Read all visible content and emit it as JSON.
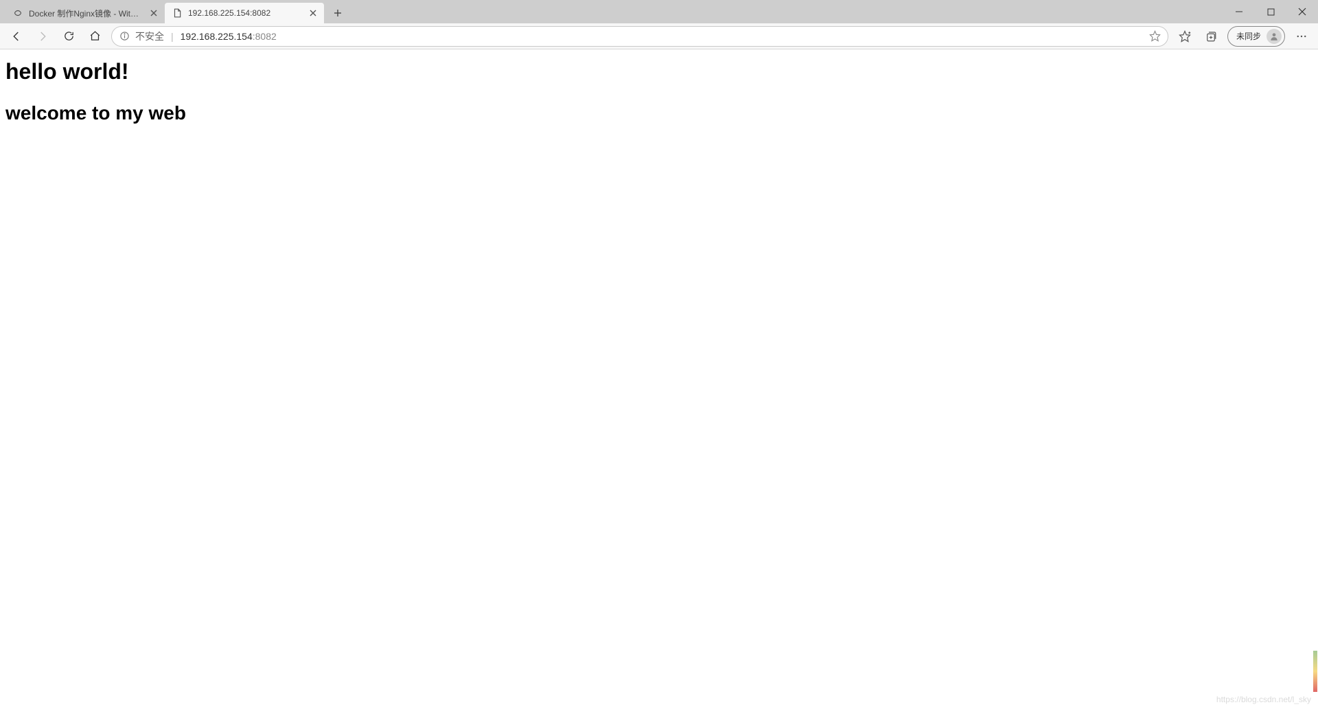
{
  "tabs": [
    {
      "title": "Docker 制作Nginx镜像 - Withfee",
      "active": false
    },
    {
      "title": "192.168.225.154:8082",
      "active": true
    }
  ],
  "addressbar": {
    "security_label": "不安全",
    "url_host": "192.168.225.154",
    "url_port": ":8082"
  },
  "sync": {
    "label": "未同步"
  },
  "page": {
    "heading1": "hello world!",
    "heading2": "welcome to my web"
  },
  "watermark": "https://blog.csdn.net/l_sky"
}
